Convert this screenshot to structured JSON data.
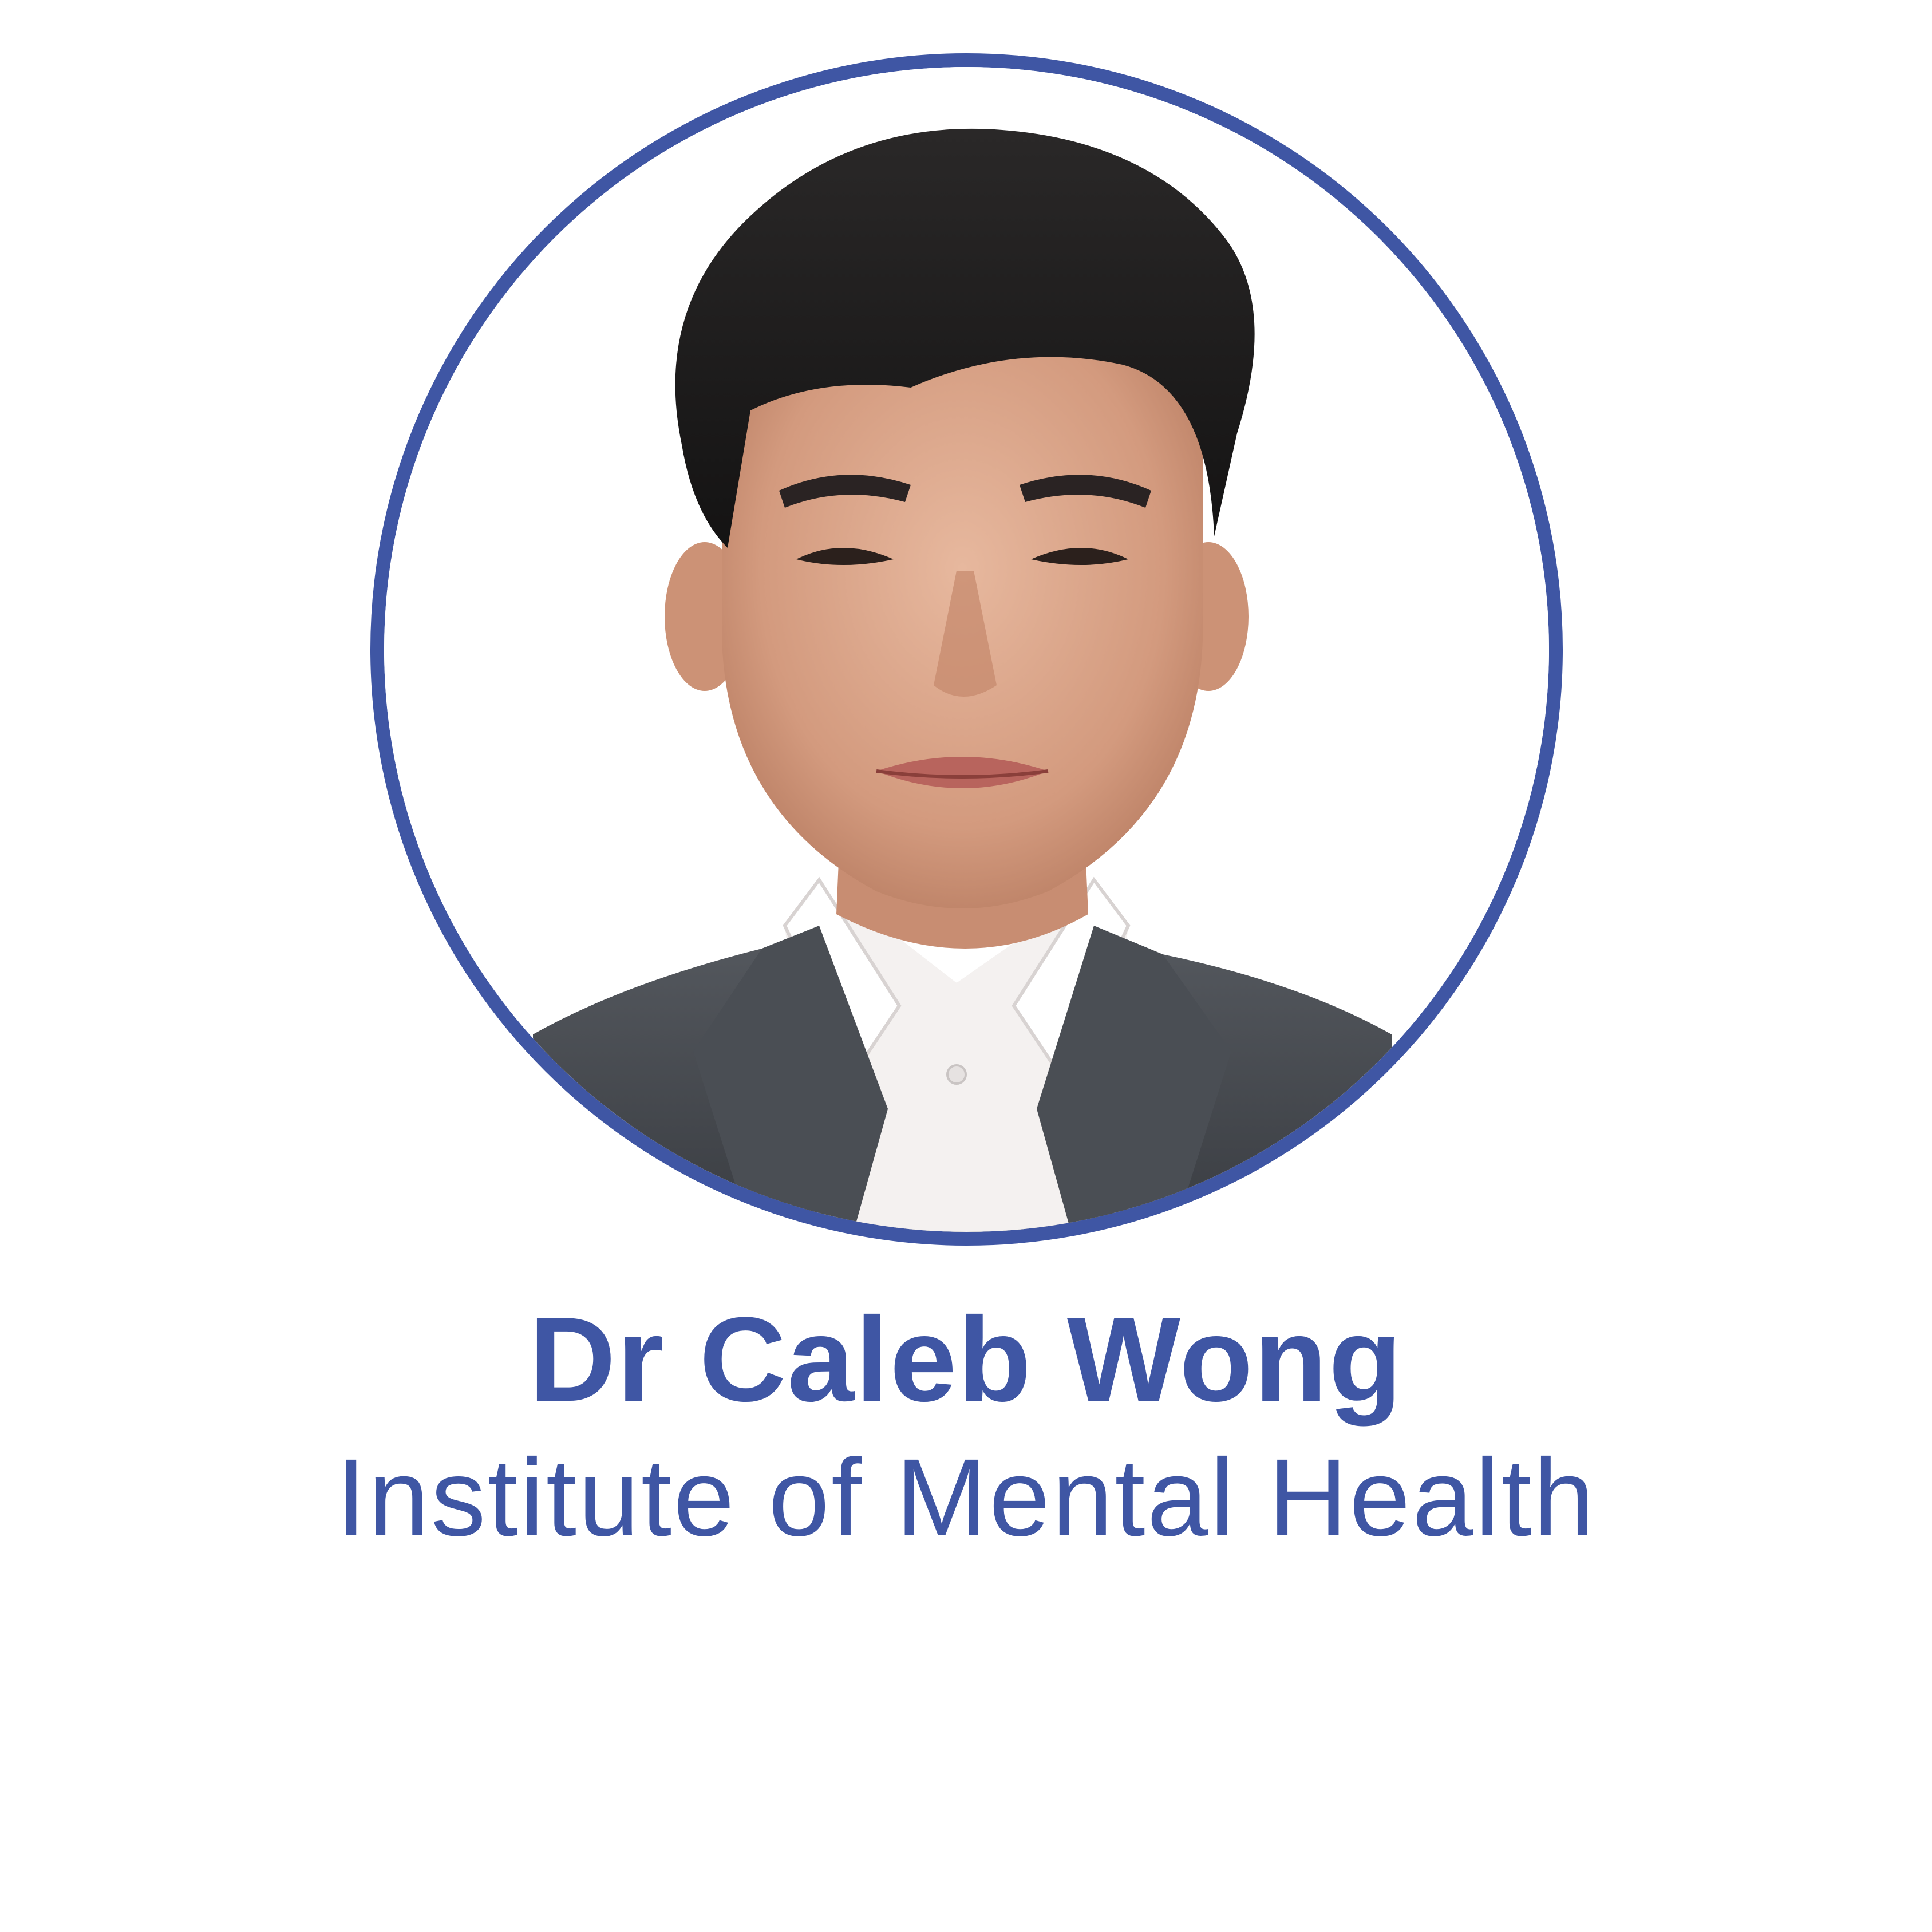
{
  "profile": {
    "name": "Dr Caleb Wong",
    "affiliation": "Institute of Mental Health"
  },
  "colors": {
    "accent": "#3f56a4",
    "background": "#ffffff"
  },
  "portrait": {
    "icon": "person-portrait-photo"
  }
}
